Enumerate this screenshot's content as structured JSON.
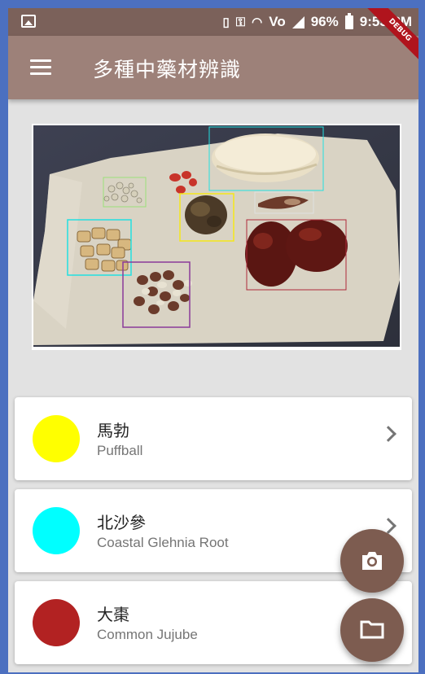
{
  "status_bar": {
    "battery_percent": "96%",
    "time": "9:53 PM",
    "network_label": "Vo"
  },
  "app_bar": {
    "title": "多種中藥材辨識",
    "debug_banner": "DEBUG"
  },
  "detections": [
    {
      "color": "#ffff00"
    },
    {
      "color": "#00ffff"
    },
    {
      "color": "#b22222"
    }
  ],
  "items": [
    {
      "name_zh": "馬勃",
      "name_en": "Puffball",
      "color": "#ffff00"
    },
    {
      "name_zh": "北沙參",
      "name_en": "Coastal Glehnia Root",
      "color": "#00ffff"
    },
    {
      "name_zh": "大棗",
      "name_en": "Common Jujube",
      "color": "#b22222"
    }
  ],
  "colors": {
    "status_bar": "#7b615a",
    "app_bar": "#9d8179",
    "fab": "#7d5c50",
    "background": "#e2e2e2"
  },
  "fabs": [
    {
      "icon": "camera-icon"
    },
    {
      "icon": "folder-icon"
    }
  ]
}
